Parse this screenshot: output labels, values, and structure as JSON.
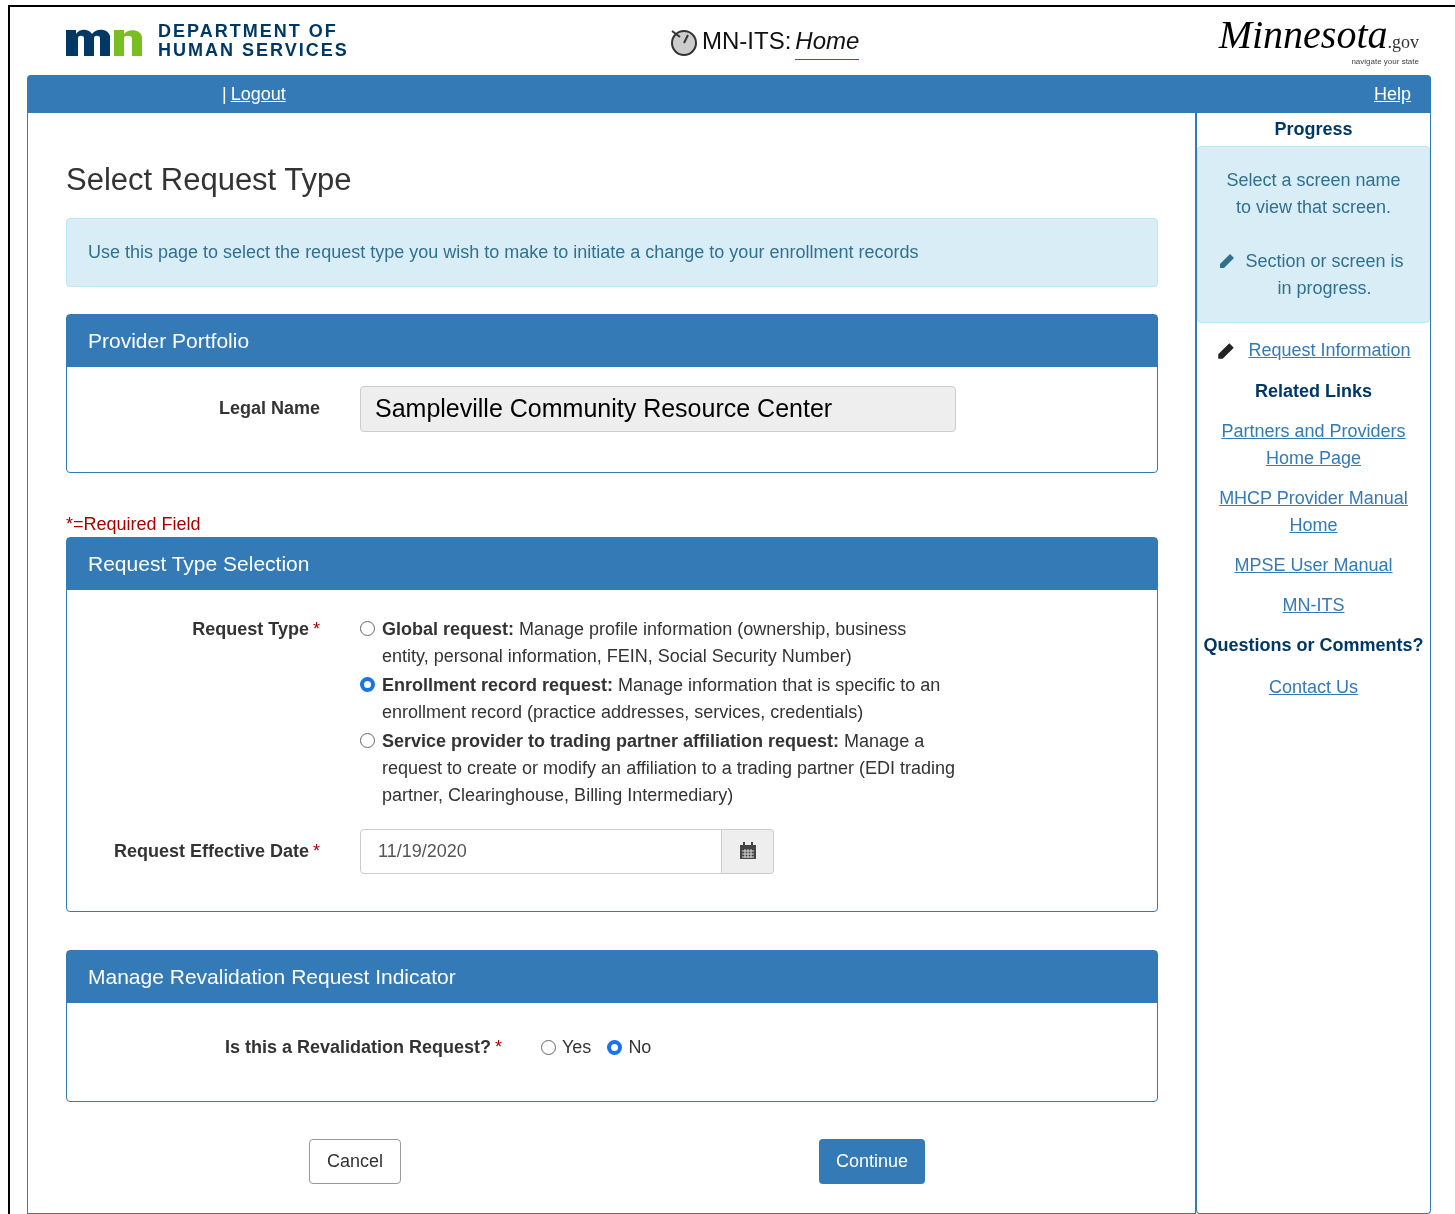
{
  "header": {
    "agency_line_1": "DEPARTMENT OF",
    "agency_line_2": "HUMAN SERVICES",
    "app_title": "MN-ITS:",
    "app_page": "Home",
    "state_logo": "Minnesota",
    "state_logo_suffix": ".gov",
    "state_tagline": "navigate your state"
  },
  "nav": {
    "separator": "|",
    "logout": "Logout",
    "help": "Help"
  },
  "page_title": "Select Request Type",
  "info": "Use this page to select the request type you wish to make to initiate a change to your enrollment records",
  "provider_portfolio": {
    "title": "Provider Portfolio",
    "label": "Legal Name",
    "value": "Sampleville Community Resource Center"
  },
  "required_note": "*=Required Field",
  "request_type_selection": {
    "title": "Request Type Selection",
    "type_label": "Request Type",
    "required_mark": "*",
    "options": [
      {
        "label": "**Global request:** Manage profile information (ownership, business entity, personal information, FEIN, Social Security Number)",
        "selected": false
      },
      {
        "label": "**Enrollment record request:** Manage information that is specific to an enrollment record (practice addresses, services, credentials)",
        "selected": true
      },
      {
        "label": "**Service provider to trading partner affiliation request:** Manage a request to create or modify an affiliation to a trading partner (EDI trading partner, Clearinghouse, Billing Intermediary)",
        "selected": false
      }
    ],
    "date_label": "Request Effective Date",
    "date_required_mark": "*",
    "date_value": "11/19/2020"
  },
  "revalidation": {
    "title": "Manage Revalidation Request Indicator",
    "question": "Is this a Revalidation Request?",
    "required_mark": "*",
    "options": [
      {
        "label": "Yes",
        "selected": false
      },
      {
        "label": "No",
        "selected": true
      }
    ]
  },
  "buttons": {
    "cancel": "Cancel",
    "continue": "Continue"
  },
  "sidebar": {
    "progress_title": "Progress",
    "help_line_1": "Select a screen name to view that screen.",
    "help_line_2": "Section or screen is in progress.",
    "progress_items": [
      {
        "label": "Request Information",
        "in_progress": true
      }
    ],
    "related_title": "Related Links",
    "related_links": [
      "Partners and Providers Home Page",
      "MHCP Provider Manual Home",
      "MPSE User Manual",
      "MN-ITS"
    ],
    "questions_title": "Questions or Comments?",
    "contact": "Contact Us"
  }
}
